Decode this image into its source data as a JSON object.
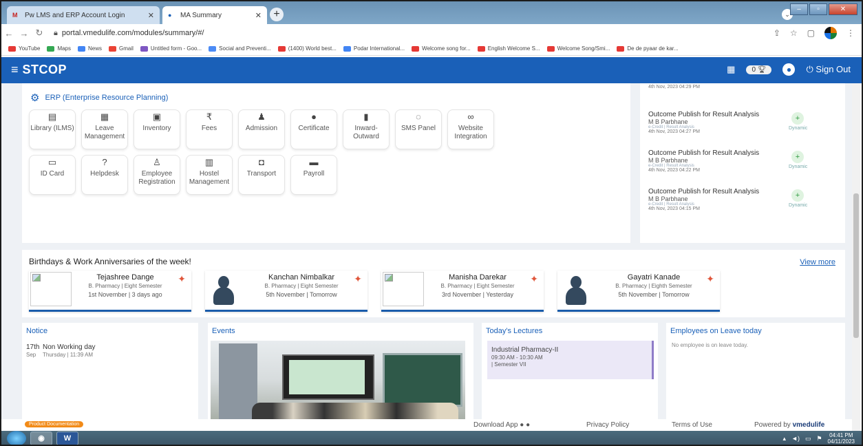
{
  "browser": {
    "tabs": [
      {
        "label": "Pw LMS and ERP Account Login"
      },
      {
        "label": "MA Summary"
      }
    ],
    "url": "portal.vmedulife.com/modules/summary/#/",
    "bookmarks": [
      {
        "label": "YouTube",
        "color": "#e53935"
      },
      {
        "label": "Maps",
        "color": "#34a853"
      },
      {
        "label": "News",
        "color": "#4285f4"
      },
      {
        "label": "Gmail",
        "color": "#ea4335"
      },
      {
        "label": "Untitled form - Goo...",
        "color": "#7e57c2"
      },
      {
        "label": "Social and Preventi...",
        "color": "#4c8bf5"
      },
      {
        "label": "(1400) World best...",
        "color": "#e53935"
      },
      {
        "label": "Podar International...",
        "color": "#4285f4"
      },
      {
        "label": "Welcome song for...",
        "color": "#e53935"
      },
      {
        "label": "English Welcome S...",
        "color": "#e53935"
      },
      {
        "label": "Welcome Song/Smi...",
        "color": "#e53935"
      },
      {
        "label": "De de pyaar de kar...",
        "color": "#e53935"
      }
    ]
  },
  "app": {
    "brand": "STCOP",
    "notif_count": "0",
    "sign_out": "Sign Out",
    "accent": "#1a60b8"
  },
  "erp": {
    "title": "ERP (Enterprise Resource Planning)",
    "tiles": [
      {
        "label": "Library (ILMS)",
        "icon": "library-icon",
        "glyph": "▤"
      },
      {
        "label": "Leave Management",
        "icon": "calendar-icon",
        "glyph": "▦"
      },
      {
        "label": "Inventory",
        "icon": "inventory-icon",
        "glyph": "▣"
      },
      {
        "label": "Fees",
        "icon": "rupee-icon",
        "glyph": "₹"
      },
      {
        "label": "Admission",
        "icon": "user-plus-icon",
        "glyph": "♟"
      },
      {
        "label": "Certificate",
        "icon": "certificate-icon",
        "glyph": "●"
      },
      {
        "label": "Inward-Outward",
        "icon": "file-icon",
        "glyph": "▮"
      },
      {
        "label": "SMS Panel",
        "icon": "chat-icon",
        "glyph": "◌"
      },
      {
        "label": "Website Integration",
        "icon": "link-icon",
        "glyph": "∞"
      },
      {
        "label": "ID Card",
        "icon": "id-card-icon",
        "glyph": "▭"
      },
      {
        "label": "Helpdesk",
        "icon": "help-icon",
        "glyph": "?"
      },
      {
        "label": "Employee Registration",
        "icon": "employee-icon",
        "glyph": "♙"
      },
      {
        "label": "Hostel Management",
        "icon": "hostel-icon",
        "glyph": "▥"
      },
      {
        "label": "Transport",
        "icon": "bus-icon",
        "glyph": "◘"
      },
      {
        "label": "Payroll",
        "icon": "wallet-icon",
        "glyph": "▬"
      }
    ]
  },
  "activity": [
    {
      "title": "Outcome Publish for Result Analysis",
      "name": "M B Parbhane",
      "sub": "e-Credit | Result Analysis",
      "date": "4th Nov, 2023 04:27 PM",
      "tag": "Dynamic"
    },
    {
      "title": "Outcome Publish for Result Analysis",
      "name": "M B Parbhane",
      "sub": "e-Credit | Result Analysis",
      "date": "4th Nov, 2023 04:22 PM",
      "tag": "Dynamic"
    },
    {
      "title": "Outcome Publish for Result Analysis",
      "name": "M B Parbhane",
      "sub": "e-Credit | Result Analysis",
      "date": "4th Nov, 2023 04:15 PM",
      "tag": "Dynamic"
    }
  ],
  "activity_top_date": "4th Nov, 2023 04:29 PM",
  "birthdays": {
    "title": "Birthdays & Work Anniversaries of the week!",
    "view_more": "View more",
    "items": [
      {
        "name": "Tejashree Dange",
        "dept": "B. Pharmacy | Eight Semester",
        "date": "1st November | 3 days ago",
        "photo": "image"
      },
      {
        "name": "Kanchan Nimbalkar",
        "dept": "B. Pharmacy | Eight Semester",
        "date": "5th November | Tomorrow",
        "photo": "avatar"
      },
      {
        "name": "Manisha Darekar",
        "dept": "B. Pharmacy | Eight Semester",
        "date": "3rd November | Yesterday",
        "photo": "image"
      },
      {
        "name": "Gayatri Kanade",
        "dept": "B. Pharmacy | Eighth Semester",
        "date": "5th November | Tomorrow",
        "photo": "avatar"
      }
    ]
  },
  "notice": {
    "title": "Notice",
    "day": "17th",
    "month": "Sep",
    "item_title": "Non Working day",
    "item_time": "Thursday | 11:39 AM"
  },
  "events": {
    "title": "Events"
  },
  "lectures": {
    "title": "Today's Lectures",
    "subject": "Industrial Pharmacy-II",
    "time": "09:30 AM - 10:30 AM",
    "semester": "| Semester VII"
  },
  "leave": {
    "title": "Employees on Leave today",
    "empty": "No employee is on leave today."
  },
  "footer": {
    "product_doc": "Product Documentation",
    "download": "Download App",
    "privacy": "Privacy Policy",
    "terms": "Terms of Use",
    "powered_prefix": "Powered by",
    "powered_brand": "vmedulife"
  },
  "taskbar": {
    "time": "04:41 PM",
    "date": "04/11/2023"
  }
}
